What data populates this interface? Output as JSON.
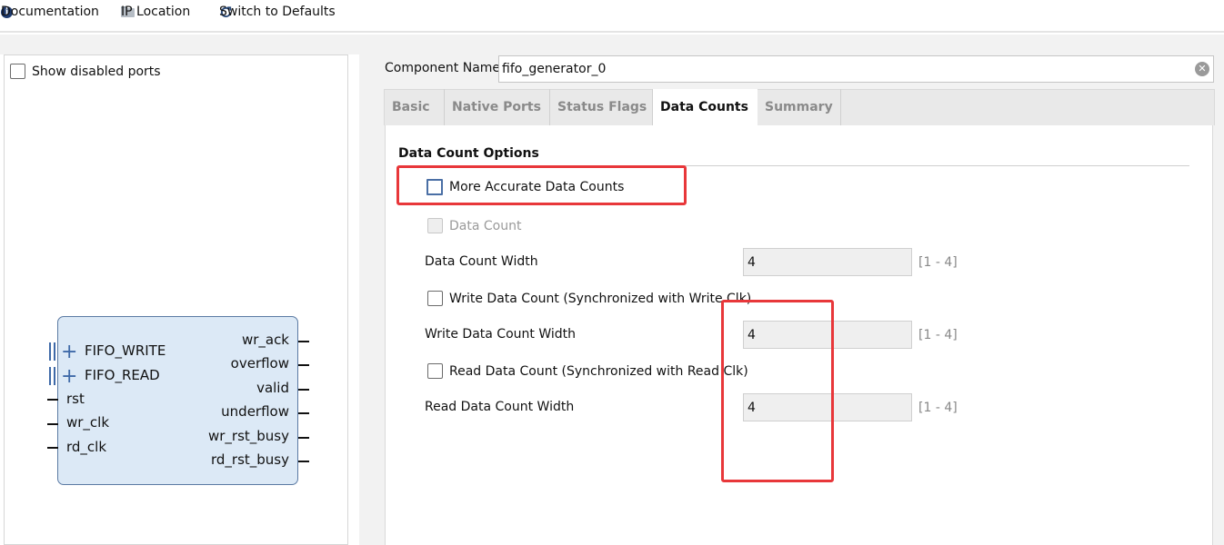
{
  "toolbar": {
    "documentation": "Documentation",
    "ip_location": "IP Location",
    "switch_defaults": "Switch to Defaults"
  },
  "left_panel": {
    "show_disabled_ports": "Show disabled ports",
    "symbol": {
      "left_ports": [
        "FIFO_WRITE",
        "FIFO_READ",
        "rst",
        "wr_clk",
        "rd_clk"
      ],
      "right_ports": [
        "wr_ack",
        "overflow",
        "valid",
        "underflow",
        "wr_rst_busy",
        "rd_rst_busy"
      ]
    }
  },
  "component": {
    "label": "Component Name",
    "value": "fifo_generator_0"
  },
  "tabs": [
    {
      "label": "Basic"
    },
    {
      "label": "Native Ports"
    },
    {
      "label": "Status Flags"
    },
    {
      "label": "Data Counts",
      "active": true
    },
    {
      "label": "Summary"
    }
  ],
  "data_counts": {
    "section_title": "Data Count Options",
    "more_accurate": "More Accurate Data Counts",
    "data_count": "Data Count",
    "data_count_width_label": "Data Count Width",
    "data_count_width": "4",
    "data_count_width_range": "[1 - 4]",
    "write_data_count": "Write Data Count (Synchronized with Write Clk)",
    "write_data_count_width_label": "Write Data Count Width",
    "write_data_count_width": "4",
    "write_data_count_width_range": "[1 - 4]",
    "read_data_count": "Read Data Count (Synchronized with Read Clk)",
    "read_data_count_width_label": "Read Data Count Width",
    "read_data_count_width": "4",
    "read_data_count_width_range": "[1 - 4]"
  },
  "colors": {
    "annotation_red": "#e8373a",
    "symbol_fill": "#dce9f6",
    "bus_blue": "#3f6aa8"
  }
}
